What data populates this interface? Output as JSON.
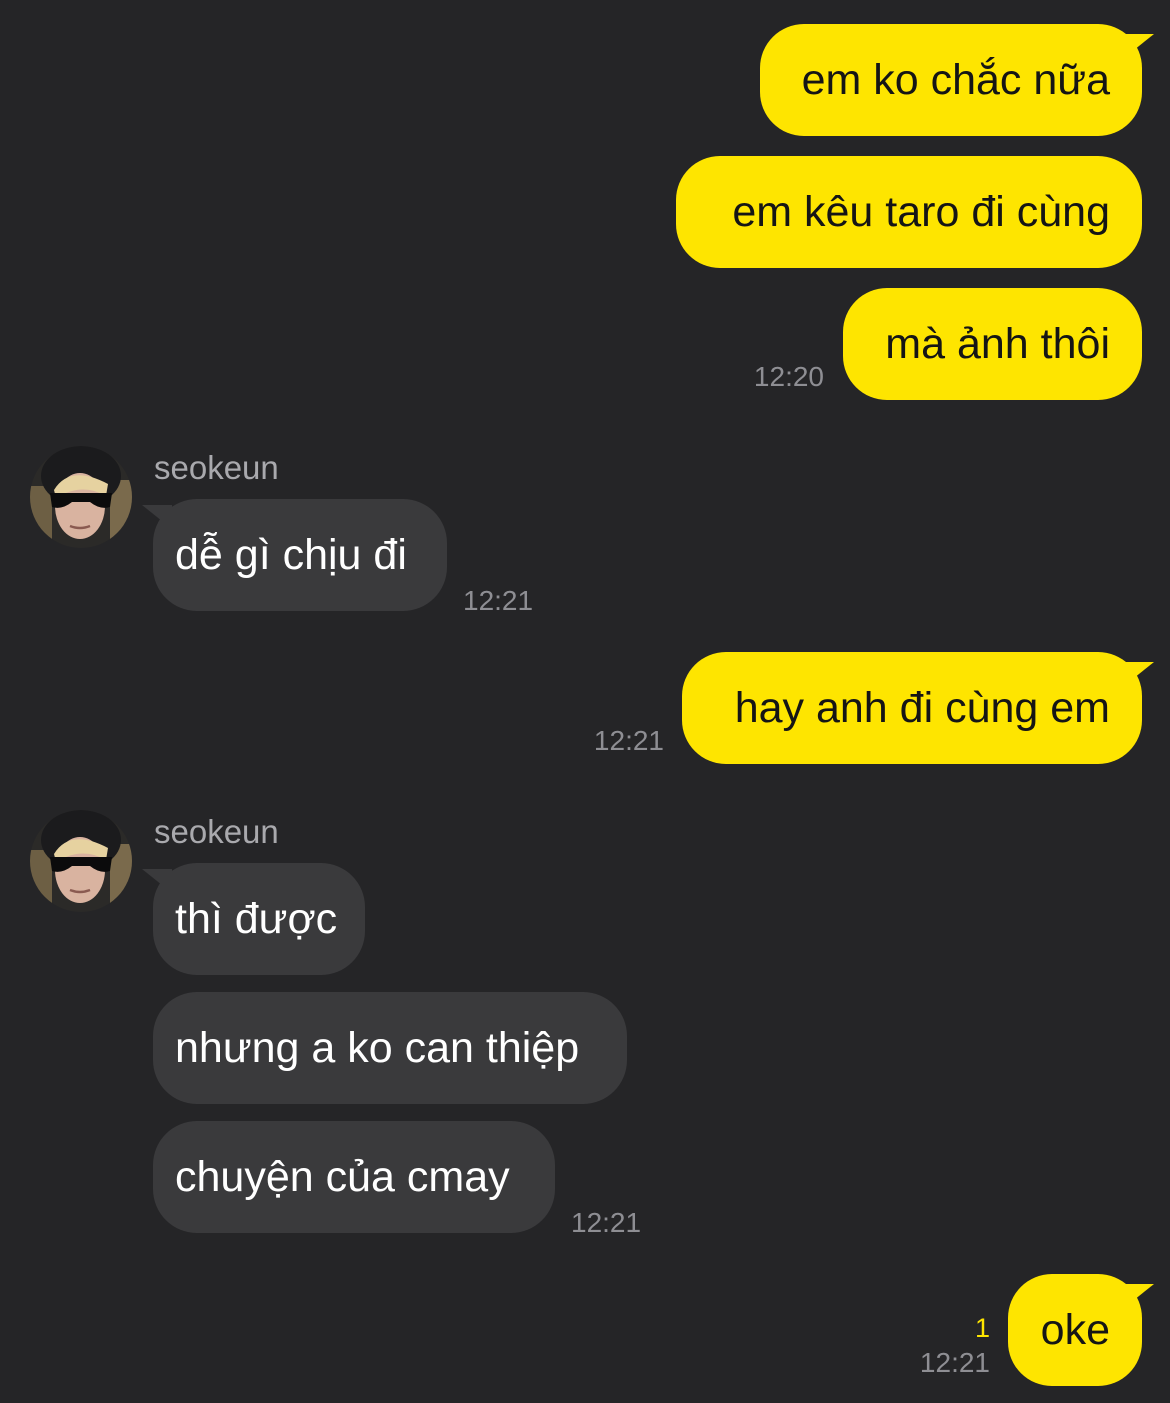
{
  "colors": {
    "background": "#252527",
    "outgoing_bubble": "#fee500",
    "incoming_bubble": "#3a3a3c",
    "timestamp": "#8e8e93",
    "unread_count": "#fee500"
  },
  "messages": [
    {
      "direction": "outgoing",
      "text": "em ko chắc nữa"
    },
    {
      "direction": "outgoing",
      "text": "em kêu taro đi cùng"
    },
    {
      "direction": "outgoing",
      "text": "mà ảnh thôi",
      "time": "12:20"
    },
    {
      "direction": "incoming",
      "sender": "seokeun",
      "avatar_icon": "profile-photo",
      "text": "dễ gì chịu đi",
      "time": "12:21"
    },
    {
      "direction": "outgoing",
      "text": "hay anh đi cùng em",
      "time": "12:21"
    },
    {
      "direction": "incoming",
      "sender": "seokeun",
      "avatar_icon": "profile-photo",
      "text": "thì được"
    },
    {
      "direction": "incoming",
      "text": "nhưng a ko can thiệp"
    },
    {
      "direction": "incoming",
      "text": "chuyện của cmay",
      "time": "12:21"
    },
    {
      "direction": "outgoing",
      "text": "oke",
      "time": "12:21",
      "unread_count": "1"
    }
  ]
}
